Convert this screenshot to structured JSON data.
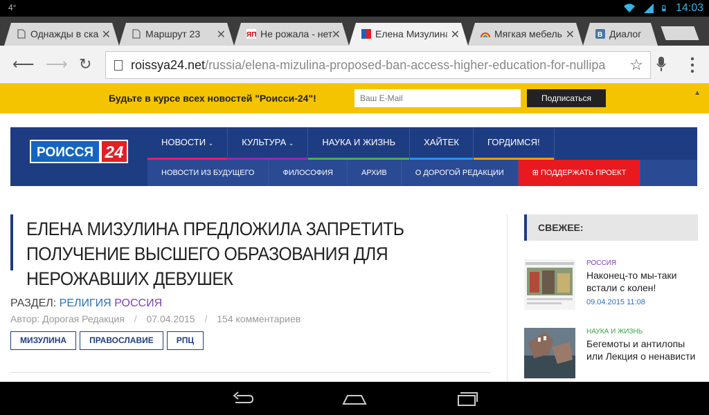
{
  "status_bar": {
    "temperature": "4°",
    "time": "14:03"
  },
  "tabs": [
    {
      "title": "Однажды в ска",
      "active": false
    },
    {
      "title": "Маршрут 23",
      "active": false
    },
    {
      "title": "Не рожала - нет",
      "active": false
    },
    {
      "title": "Елена Мизулина",
      "active": true
    },
    {
      "title": "Мягкая мебель",
      "active": false
    },
    {
      "title": "Диалог",
      "active": false
    }
  ],
  "omnibox": {
    "url_host": "roissya24.net",
    "url_path": "/russia/elena-mizulina-proposed-ban-access-higher-education-for-nullipa"
  },
  "subscribe_bar": {
    "message": "Будьте в курсе всех новостей \"Роисси-24\"!",
    "email_placeholder": "Ваш E-Mail",
    "button_label": "Подписаться"
  },
  "site": {
    "logo_word": "РОИССЯ",
    "logo_number": "24",
    "nav_primary": [
      {
        "label": "НОВОСТИ",
        "dropdown": true,
        "accent": "#e91e63"
      },
      {
        "label": "КУЛЬТУРА",
        "dropdown": true,
        "accent": "#9c27b0"
      },
      {
        "label": "НАУКА И ЖИЗНЬ",
        "dropdown": false,
        "accent": "#4caf50"
      },
      {
        "label": "ХАЙТЕК",
        "dropdown": false,
        "accent": "#2196f3"
      },
      {
        "label": "ГОРДИМСЯ!",
        "dropdown": false,
        "accent": "#ff9800"
      }
    ],
    "nav_secondary": [
      {
        "label": "НОВОСТИ ИЗ БУДУЩЕГО",
        "donate": false
      },
      {
        "label": "ФИЛОСОФИЯ",
        "donate": false
      },
      {
        "label": "АРХИВ",
        "donate": false
      },
      {
        "label": "О ДОРОГОЙ РЕДАКЦИИ",
        "donate": false
      },
      {
        "label": "ПОДДЕРЖАТЬ ПРОЕКТ",
        "donate": true
      }
    ]
  },
  "article": {
    "title": "ЕЛЕНА МИЗУЛИНА ПРЕДЛОЖИЛА ЗАПРЕТИТЬ ПОЛУЧЕНИЕ ВЫСШЕГО ОБРАЗОВАНИЯ ДЛЯ НЕРОЖАВШИХ ДЕВУШЕК",
    "section_label": "РАЗДЕЛ:",
    "section_religion": "РЕЛИГИЯ",
    "section_russia": "РОССИЯ",
    "author": "Автор: Дорогая Редакция",
    "date": "07.04.2015",
    "comments": "154 комментариев",
    "tags": [
      "МИЗУЛИНА",
      "ПРАВОСЛАВИЕ",
      "РПЦ"
    ]
  },
  "sidebar": {
    "heading": "СВЕЖЕЕ:",
    "items": [
      {
        "category": "РОССИЯ",
        "category_color": "#7b3fb5",
        "headline": "Наконец-то мы-таки встали с колен!",
        "date": "09.04.2015 11:08"
      },
      {
        "category": "НАУКА И ЖИЗНЬ",
        "category_color": "#43a047",
        "headline": "Бегемоты и антилопы или Лекция о ненависти",
        "date": ""
      }
    ]
  },
  "colors": {
    "brand_blue": "#1e3c82",
    "subscribe_yellow": "#f5c400",
    "donate_red": "#e8191f",
    "status_time": "#33b5e5"
  }
}
